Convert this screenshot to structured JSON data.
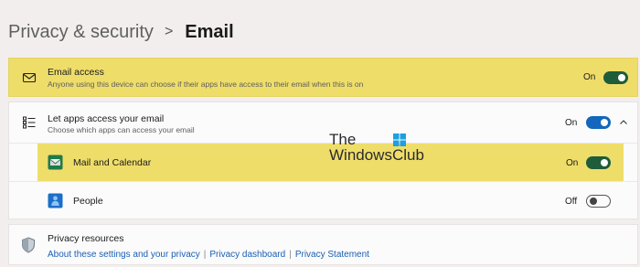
{
  "breadcrumb": {
    "parent": "Privacy & security",
    "separator": ">",
    "current": "Email"
  },
  "email_access": {
    "title": "Email access",
    "subtitle": "Anyone using this device can choose if their apps have access to their email when this is on",
    "state": "On",
    "icon": "mail-icon"
  },
  "let_apps": {
    "title": "Let apps access your email",
    "subtitle": "Choose which apps can access your email",
    "state": "On",
    "icon": "list-icon",
    "expanded": true
  },
  "apps": [
    {
      "name": "Mail and Calendar",
      "state": "On",
      "icon": "mail-calendar-app-icon"
    },
    {
      "name": "People",
      "state": "Off",
      "icon": "people-app-icon"
    }
  ],
  "privacy_resources": {
    "title": "Privacy resources",
    "icon": "shield-icon",
    "links": [
      "About these settings and your privacy",
      "Privacy dashboard",
      "Privacy Statement"
    ],
    "separator": "|"
  },
  "watermark": {
    "line1": "The",
    "line2": "WindowsClub"
  },
  "colors": {
    "highlight": "#efdd6a",
    "toggle_on_dark": "#1e5c3a",
    "toggle_on_blue": "#1467ba",
    "link": "#1a5fb4"
  }
}
